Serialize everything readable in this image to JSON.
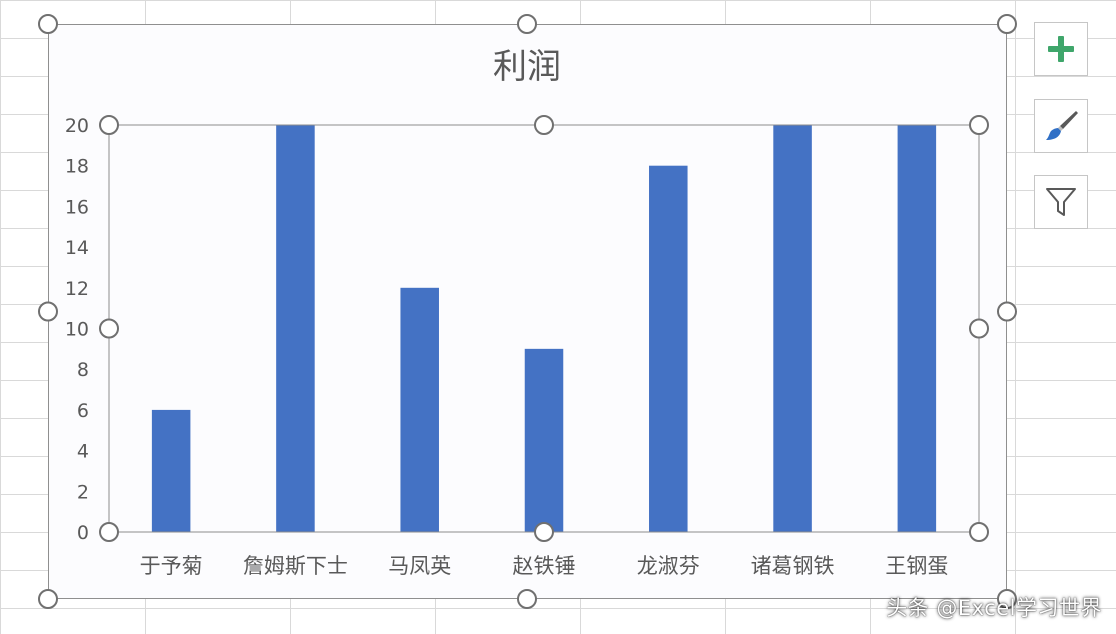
{
  "chart_data": {
    "type": "bar",
    "title": "利润",
    "categories": [
      "于予菊",
      "詹姆斯下士",
      "马凤英",
      "赵铁锤",
      "龙淑芬",
      "诸葛钢铁",
      "王钢蛋"
    ],
    "values": [
      6,
      20,
      12,
      9,
      18,
      20,
      20
    ],
    "ylim": [
      0,
      20
    ],
    "yticks": [
      "0",
      "2",
      "4",
      "6",
      "8",
      "10",
      "12",
      "14",
      "16",
      "18",
      "20"
    ],
    "grid": false,
    "legend": "none",
    "bar_color": "#4472c4"
  },
  "chart_buttons": {
    "add_icon": "plus-icon",
    "style_icon": "paintbrush-icon",
    "filter_icon": "funnel-icon",
    "add_color": "#3fa66b",
    "style_color": "#2f6fc6"
  },
  "watermark": "头条 @Excel学习世界"
}
